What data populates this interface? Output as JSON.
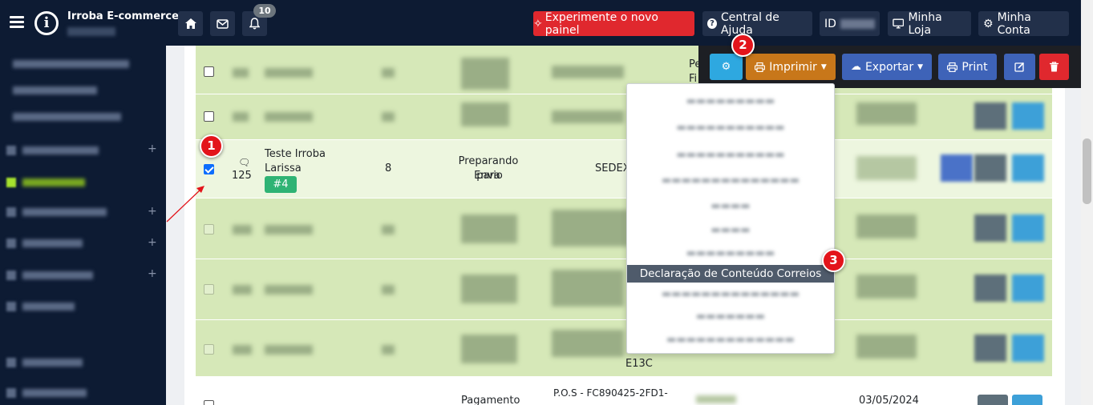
{
  "header": {
    "brand": "Irroba E-commerce",
    "notifications_count": "10",
    "try_new_panel": "Experimente o novo painel",
    "help_center": "Central de Ajuda",
    "id_label": "ID",
    "my_store": "Minha Loja",
    "my_account": "Minha Conta"
  },
  "toolbar": {
    "print_label": "Imprimir",
    "export_label": "Exportar",
    "print_en_label": "Print"
  },
  "dropdown": {
    "active_item": "Declaração de Conteúdo Correios"
  },
  "selected_row": {
    "comments": "125",
    "customer_line1": "Teste Irroba",
    "customer_line2": "Larissa",
    "order_tag": "#4",
    "qty": "8",
    "status_line1": "Preparando para",
    "status_line2": "Envio",
    "shipping": "SEDEX"
  },
  "partial": {
    "row1_col": "Pe",
    "row1_col2": "Fi",
    "row6_code_tail": "E13C",
    "last_status": "Pagamento",
    "last_code": "P.O.S - FC890425-2FD1-",
    "last_date": "03/05/2024"
  },
  "annotations": {
    "m1": "1",
    "m2": "2",
    "m3": "3"
  },
  "colors": {
    "navbar": "#0d1b33",
    "row_green": "#d6e8b8",
    "danger": "#e0282e",
    "print_orange": "#c8771a",
    "export_blue": "#3e63b8"
  }
}
